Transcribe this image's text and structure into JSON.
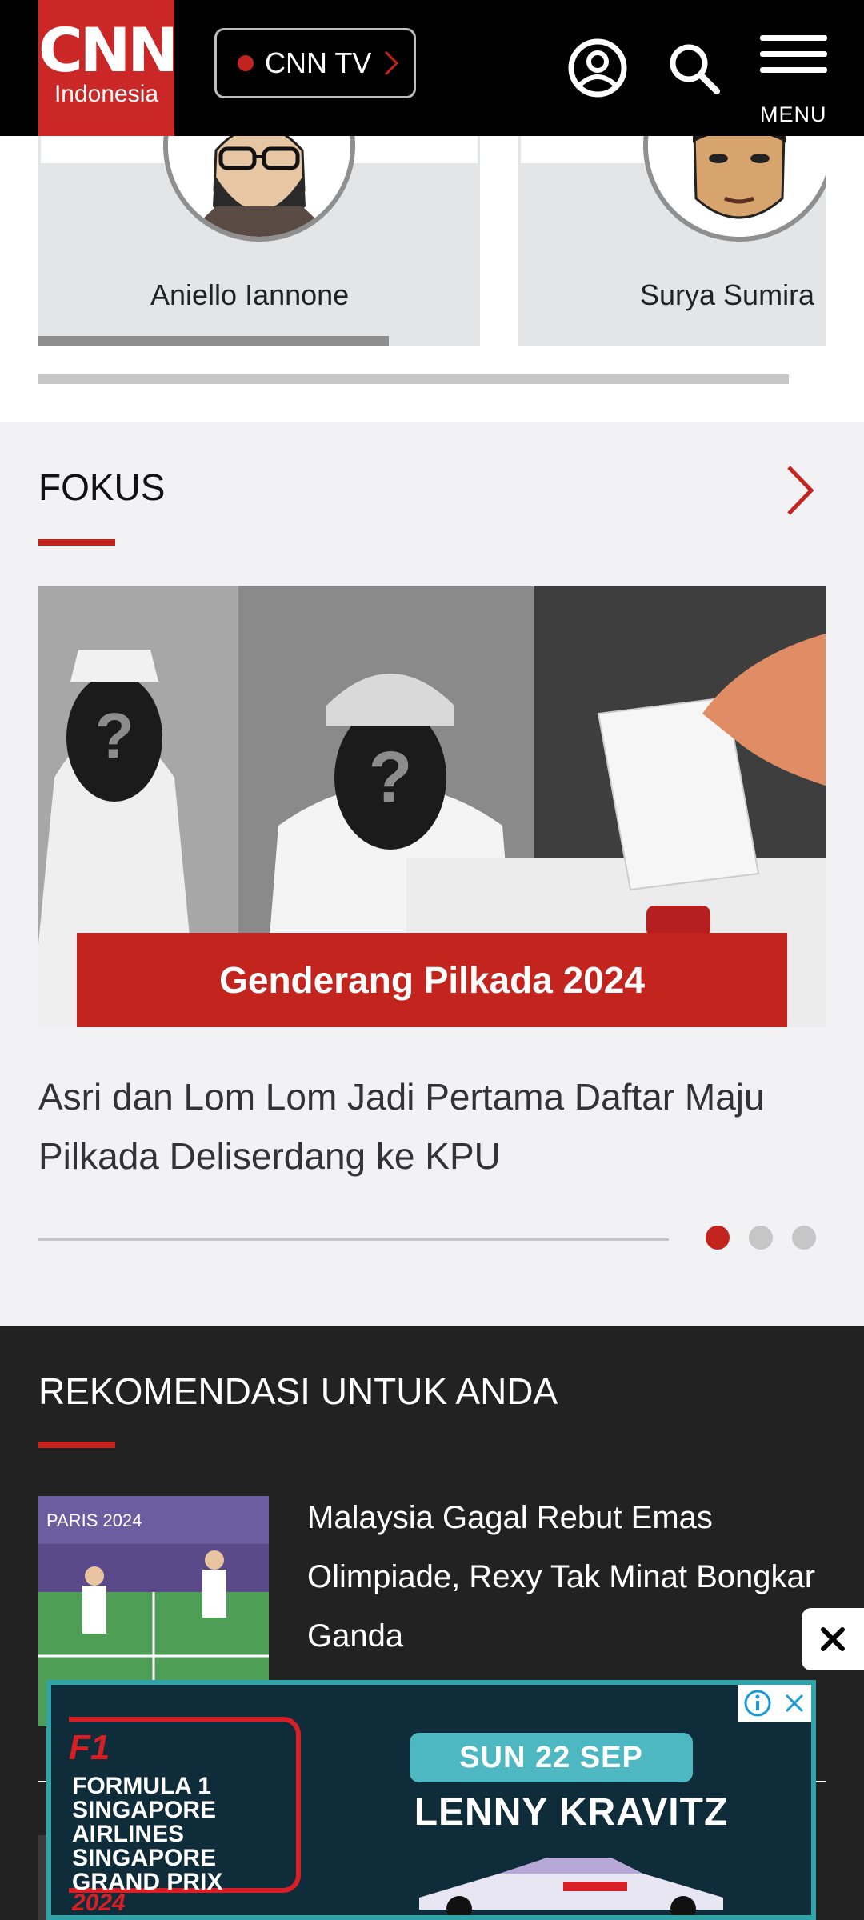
{
  "header": {
    "logo_main": "CNN",
    "logo_sub": "Indonesia",
    "tv_label": "CNN TV",
    "menu_label": "MENU"
  },
  "columnists": [
    {
      "name": "Aniello Iannone"
    },
    {
      "name": "Surya Sumira"
    }
  ],
  "fokus": {
    "title": "FOKUS",
    "banner_label": "Genderang Pilkada 2024",
    "headline": "Asri dan Lom Lom Jadi Pertama Daftar Maju Pilkada Deliserdang ke KPU",
    "page_dots": 3,
    "active_dot": 0
  },
  "rekomendasi": {
    "title": "REKOMENDASI UNTUK ANDA",
    "items": [
      {
        "title": "Malaysia Gagal Rebut Emas Olimpiade, Rexy Tak Minat Bongkar Ganda",
        "thumb_text": "PARIS 2024"
      }
    ]
  },
  "ad": {
    "brand": "F1",
    "lines": [
      "FORMULA 1",
      "SINGAPORE",
      "AIRLINES",
      "SINGAPORE",
      "GRAND PRIX"
    ],
    "year": "2024",
    "date": "SUN 22 SEP",
    "artist": "LENNY KRAVITZ"
  },
  "colors": {
    "brand_red": "#cc2727",
    "accent_red": "#c4241e",
    "header_bg": "#000000",
    "dark_section_bg": "#222222",
    "ad_teal": "#2fa3a8"
  }
}
